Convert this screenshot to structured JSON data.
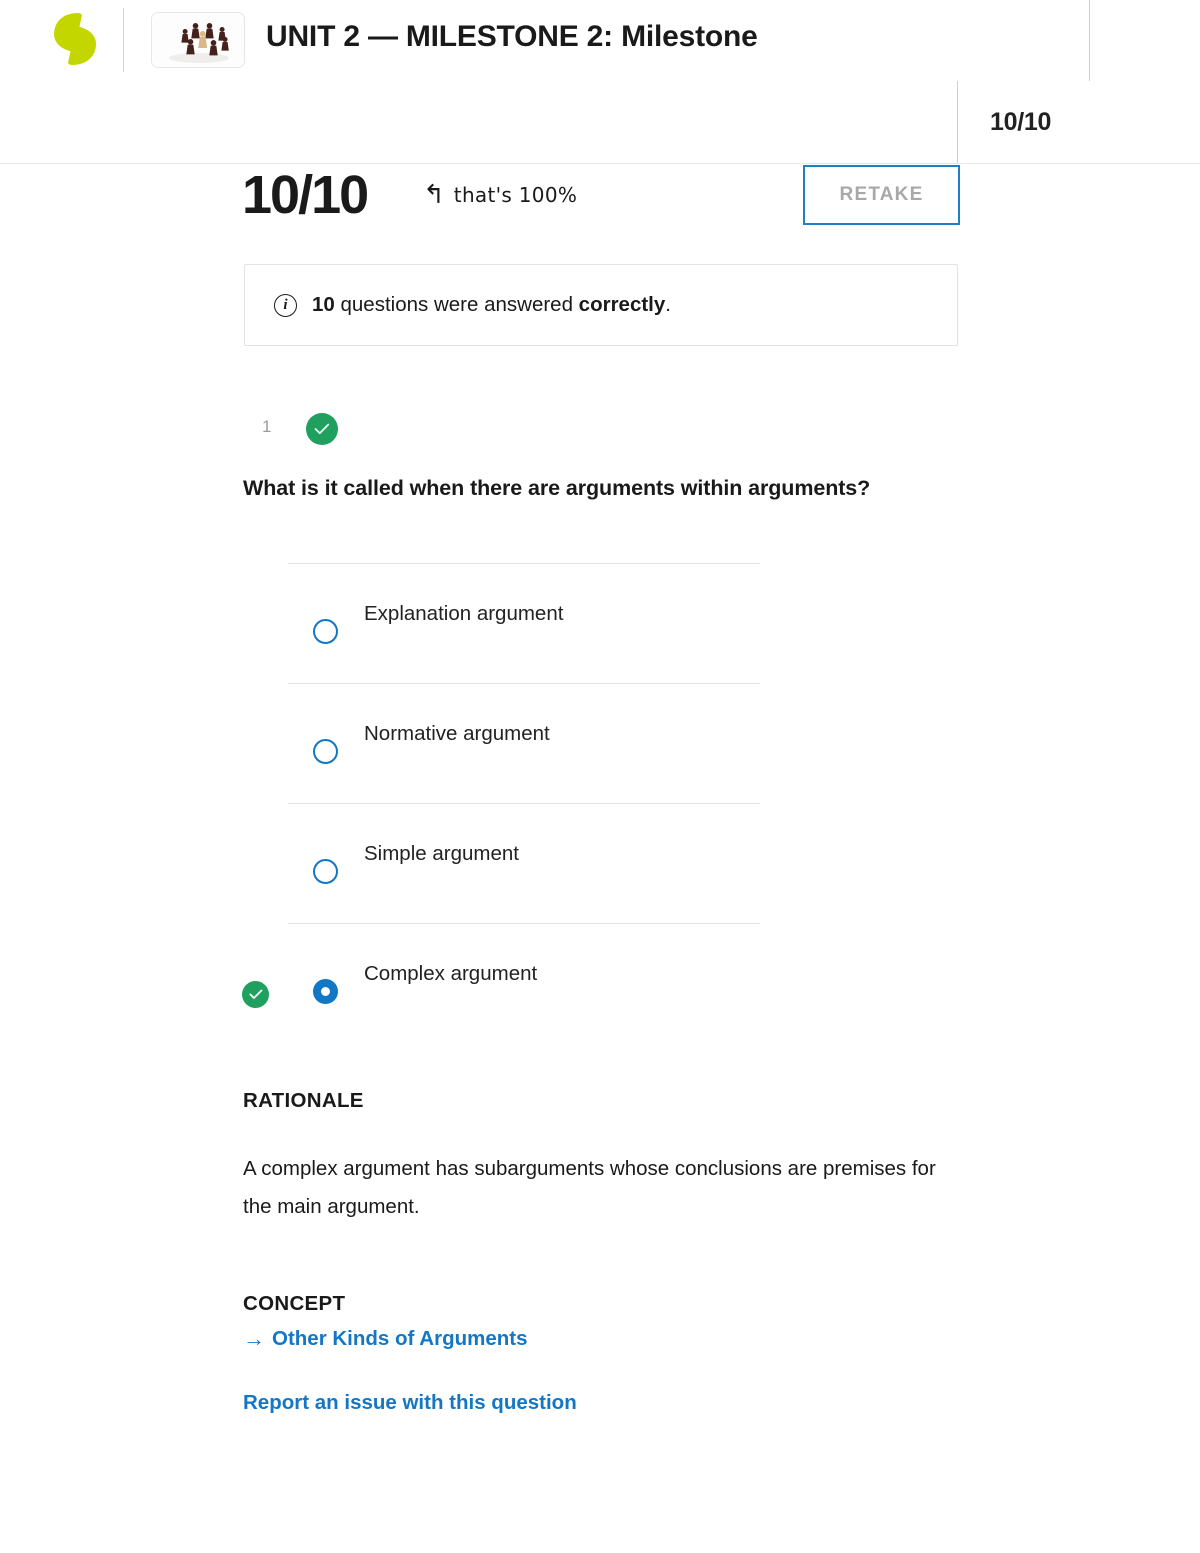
{
  "header": {
    "logo_alt": "sophia-logo",
    "thumbnail_alt": "chess-pawns-thumbnail",
    "title": "UNIT 2 — MILESTONE 2: Milestone"
  },
  "score_strip": {
    "score": "10/10"
  },
  "result": {
    "score": "10/10",
    "annotation_arrow": "↰",
    "annotation_text": "that's 100%",
    "retake_label": "RETAKE"
  },
  "info_banner": {
    "icon": "info-icon",
    "count": "10",
    "text_middle": " questions were answered ",
    "emphasis": "correctly",
    "text_end": "."
  },
  "question": {
    "number": "1",
    "status": "correct",
    "text": "What is it called when there are arguments within arguments?",
    "options": [
      {
        "label": "Explanation argument",
        "selected": false,
        "correct": false
      },
      {
        "label": "Normative argument",
        "selected": false,
        "correct": false
      },
      {
        "label": "Simple argument",
        "selected": false,
        "correct": false
      },
      {
        "label": "Complex argument",
        "selected": true,
        "correct": true
      }
    ],
    "rationale_heading": "RATIONALE",
    "rationale_body": "A complex argument has subarguments whose conclusions are premises for the main argument.",
    "concept_heading": "CONCEPT",
    "concept_arrow": "→",
    "concept_link": "Other Kinds of Arguments",
    "report_link": "Report an issue with this question"
  },
  "colors": {
    "brand_green": "#c3d600",
    "correct_green": "#20a05e",
    "link_blue": "#1477c6",
    "accent_blue": "#1277c4"
  }
}
